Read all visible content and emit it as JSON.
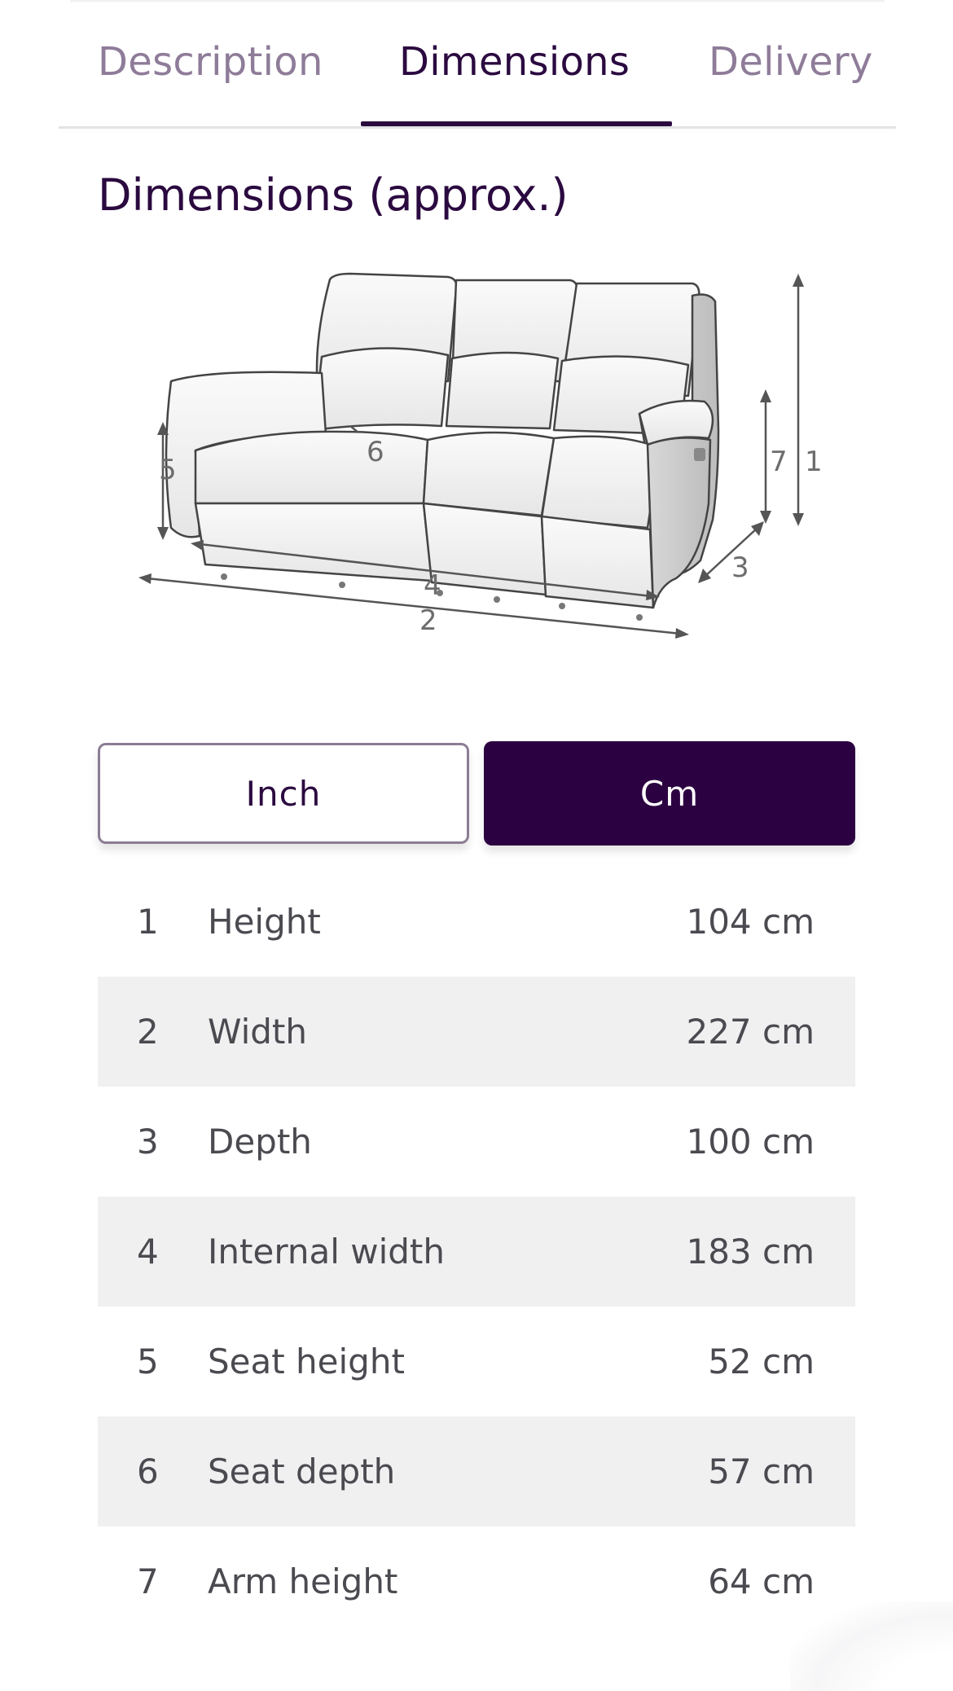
{
  "tabs": {
    "description": "Description",
    "dimensions": "Dimensions",
    "delivery": "Delivery",
    "active": "Dimensions"
  },
  "section_title": "Dimensions (approx.)",
  "diagram": {
    "labels": [
      "1",
      "2",
      "3",
      "4",
      "5",
      "6",
      "7"
    ]
  },
  "units": {
    "inch": "Inch",
    "cm": "Cm",
    "selected": "Cm"
  },
  "dimensions": [
    {
      "num": "1",
      "label": "Height",
      "value": "104 cm"
    },
    {
      "num": "2",
      "label": "Width",
      "value": "227 cm"
    },
    {
      "num": "3",
      "label": "Depth",
      "value": "100 cm"
    },
    {
      "num": "4",
      "label": "Internal width",
      "value": "183 cm"
    },
    {
      "num": "5",
      "label": "Seat height",
      "value": "52 cm"
    },
    {
      "num": "6",
      "label": "Seat depth",
      "value": "57 cm"
    },
    {
      "num": "7",
      "label": "Arm height",
      "value": "64 cm"
    }
  ],
  "colors": {
    "brand": "#2c0142",
    "tab_inactive": "#8e7c99",
    "row_shade": "#f0f0f1"
  }
}
